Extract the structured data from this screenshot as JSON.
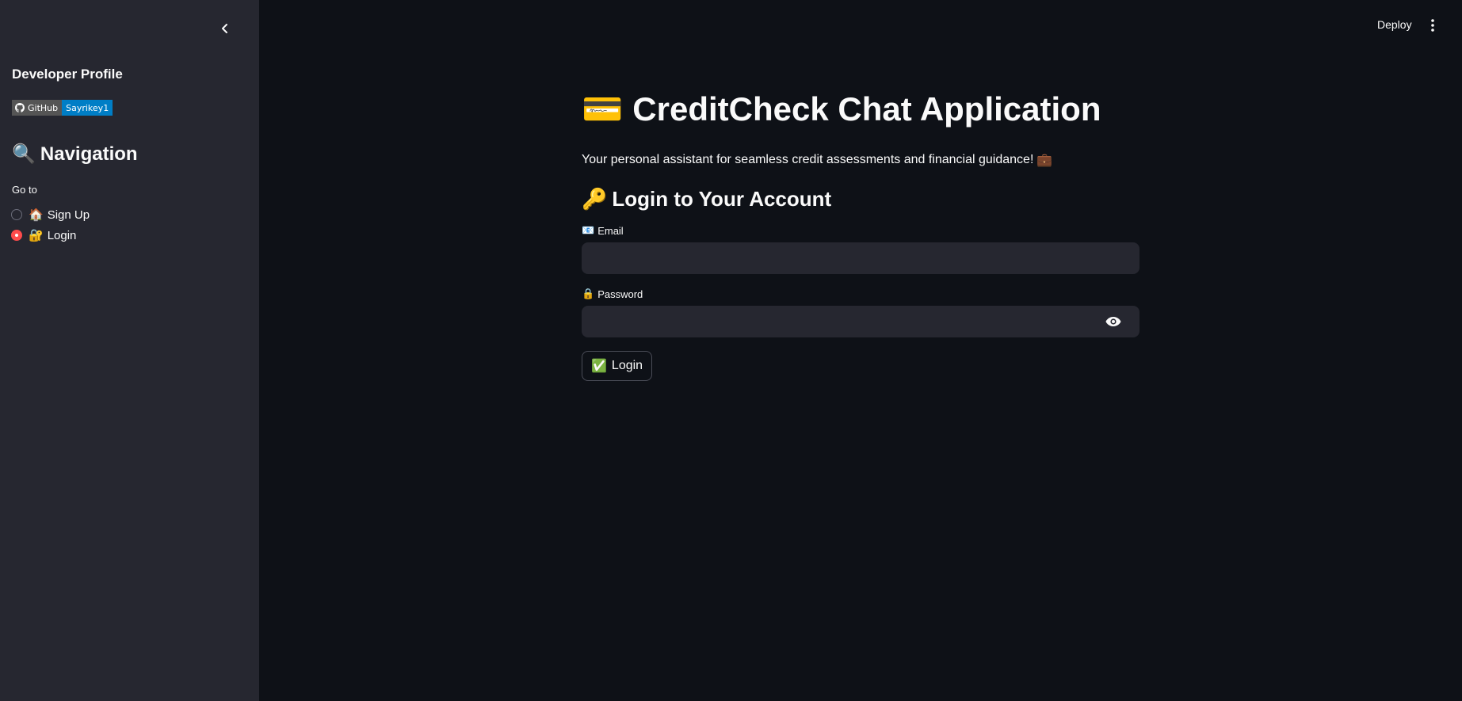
{
  "sidebar": {
    "developer_title": "Developer Profile",
    "badge": {
      "left": "GitHub",
      "right": "Sayrikey1"
    },
    "nav_icon": "🔍",
    "nav_title": "Navigation",
    "goto_label": "Go to",
    "options": [
      {
        "icon": "🏠",
        "label": "Sign Up",
        "selected": false
      },
      {
        "icon": "🔐",
        "label": "Login",
        "selected": true
      }
    ]
  },
  "header": {
    "deploy_label": "Deploy"
  },
  "main": {
    "title_icon": "💳",
    "title": "CreditCheck Chat Application",
    "subtitle": "Your personal assistant for seamless credit assessments and financial guidance!",
    "subtitle_icon": "💼",
    "login_icon": "🔑",
    "login_title": "Login to Your Account",
    "email_icon": "📧",
    "email_label": "Email",
    "email_value": "",
    "password_icon": "🔒",
    "password_label": "Password",
    "password_value": "",
    "login_button_icon": "✅",
    "login_button_label": "Login"
  },
  "colors": {
    "background": "#0e1117",
    "sidebar": "#262730",
    "accent": "#ff4b4b",
    "badge_blue": "#007ec6",
    "badge_gray": "#555555"
  }
}
